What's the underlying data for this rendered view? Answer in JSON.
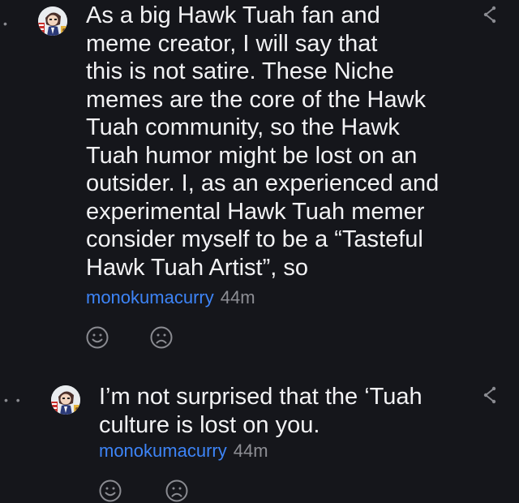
{
  "comments": [
    {
      "body_lines": [
        "As a big Hawk Tuah fan and",
        "meme creator, I will say that",
        "this is not satire. These Niche",
        "memes are the core of the Hawk",
        "Tuah community, so the Hawk",
        "Tuah humor might be lost on an",
        "outsider. I, as an experienced and",
        "experimental Hawk Tuah memer",
        "consider myself to be a “Tasteful",
        "Hawk Tuah Artist”, so"
      ],
      "author": "monokumacurry",
      "time": "44m",
      "thread_indicator": "•",
      "icons": {
        "avatar": "user-avatar-icon",
        "share": "share-icon",
        "happy": "happy-face-icon",
        "sad": "sad-face-icon"
      }
    },
    {
      "body_lines": [
        "I’m not surprised that the ‘Tuah",
        "culture is lost on you."
      ],
      "author": "monokumacurry",
      "time": "44m",
      "thread_indicator": "• •",
      "icons": {
        "avatar": "user-avatar-icon",
        "share": "share-icon",
        "happy": "happy-face-icon",
        "sad": "sad-face-icon"
      }
    }
  ],
  "colors": {
    "background": "#15161b",
    "text": "#f2f2f4",
    "author_link": "#3d84f7",
    "meta_gray": "#8d8e94"
  }
}
